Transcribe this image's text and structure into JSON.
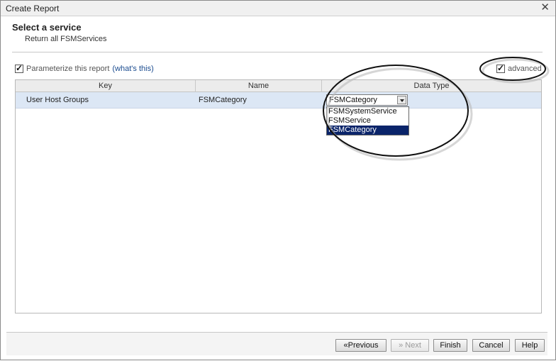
{
  "window": {
    "title": "Create Report"
  },
  "header": {
    "title": "Select a service",
    "subtitle": "Return all FSMServices"
  },
  "options": {
    "parameterize_label": "Parameterize this report",
    "whats_this_link": "(what's this)",
    "parameterize_checked": true,
    "advanced_label": "advanced",
    "advanced_checked": true
  },
  "table": {
    "columns": [
      "Key",
      "Name",
      "Data Type"
    ],
    "rows": [
      {
        "key": "User Host Groups",
        "name": "FSMCategory",
        "data_type": "FSMCategory"
      }
    ]
  },
  "data_type_dropdown": {
    "selected": "FSMCategory",
    "options": [
      "FSMSystemService",
      "FSMService",
      "FSMCategory"
    ]
  },
  "buttons": {
    "previous": "«Previous",
    "next": "» Next",
    "finish": "Finish",
    "cancel": "Cancel",
    "help": "Help"
  },
  "colors": {
    "row_selected": "#dce7f5",
    "dropdown_highlight": "#0a246a",
    "link": "#1a4b8f"
  }
}
